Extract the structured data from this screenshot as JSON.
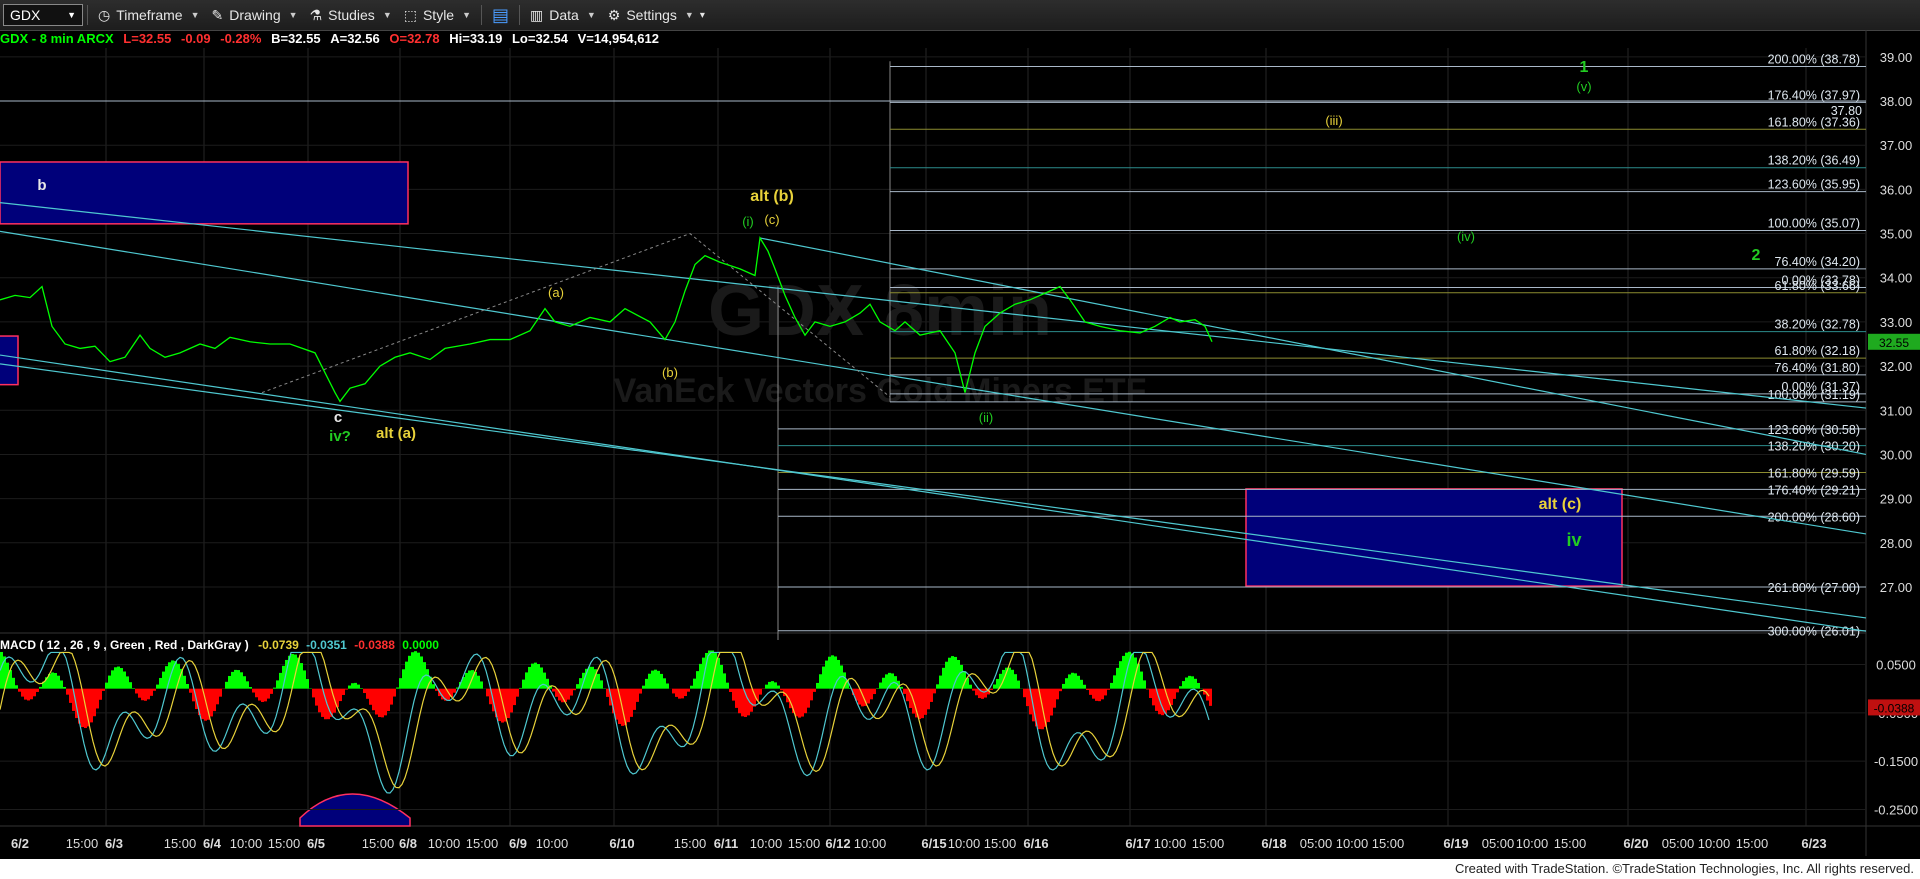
{
  "toolbar": {
    "symbol": "GDX",
    "items": [
      {
        "label": "Timeframe",
        "icon": "clock-icon"
      },
      {
        "label": "Drawing",
        "icon": "pencil-icon"
      },
      {
        "label": "Studies",
        "icon": "flask-icon"
      },
      {
        "label": "Style",
        "icon": "style-icon"
      },
      {
        "label": "Data",
        "icon": "bars-icon"
      },
      {
        "label": "Settings",
        "icon": "gear-icon"
      }
    ]
  },
  "quote": {
    "title": "GDX - 8 min  ARCX",
    "last": "L=32.55",
    "change": "-0.09",
    "pct": "-0.28%",
    "bid": "B=32.55",
    "ask": "A=32.56",
    "open": "O=32.78",
    "high": "Hi=33.19",
    "low": "Lo=32.54",
    "volume": "V=14,954,612"
  },
  "watermark": {
    "line1": "GDX 8min",
    "line2": "VanEck Vectors Gold Miners ETF"
  },
  "colors": {
    "up": "#00ff00",
    "down": "#ff0000",
    "wave_green": "#22cc22",
    "wave_yellow": "#e8d23a",
    "cyan": "#4fc8d0",
    "macd_line": "#4fc8d0",
    "signal_line": "#e8d23a",
    "box_fill": "#00007a",
    "box_border": "#ff3060"
  },
  "chart_data": [
    {
      "type": "line",
      "name": "GDX 8 min",
      "x_labels": [
        "6/2",
        "15:00",
        "6/3",
        "15:00",
        "6/4",
        "10:00",
        "15:00",
        "6/5",
        "15:00",
        "6/8",
        "10:00",
        "15:00",
        "6/9",
        "10:00",
        "6/10",
        "15:00",
        "6/11",
        "10:00",
        "15:00",
        "6/12",
        "10:00",
        "6/15",
        "10:00",
        "15:00",
        "6/16",
        "6/17",
        "10:00",
        "15:00",
        "6/18",
        "05:00",
        "10:00",
        "15:00",
        "6/19",
        "05:00",
        "10:00",
        "15:00",
        "6/20",
        "05:00",
        "10:00",
        "15:00",
        "6/23"
      ],
      "y_ticks": [
        39.0,
        38.0,
        37.0,
        36.0,
        35.0,
        34.0,
        33.0,
        32.0,
        31.0,
        30.0,
        29.0,
        28.0,
        27.0
      ],
      "ylim": [
        25.8,
        39.2
      ],
      "last_price": 32.55,
      "price_path": [
        [
          0,
          33.5
        ],
        [
          15,
          33.6
        ],
        [
          30,
          33.55
        ],
        [
          42,
          33.8
        ],
        [
          52,
          32.9
        ],
        [
          65,
          32.5
        ],
        [
          80,
          32.4
        ],
        [
          95,
          32.45
        ],
        [
          110,
          32.1
        ],
        [
          125,
          32.2
        ],
        [
          140,
          32.7
        ],
        [
          150,
          32.4
        ],
        [
          165,
          32.2
        ],
        [
          180,
          32.3
        ],
        [
          200,
          32.5
        ],
        [
          215,
          32.4
        ],
        [
          230,
          32.65
        ],
        [
          250,
          32.55
        ],
        [
          270,
          32.5
        ],
        [
          290,
          32.5
        ],
        [
          315,
          32.3
        ],
        [
          335,
          31.4
        ],
        [
          340,
          31.2
        ],
        [
          350,
          31.5
        ],
        [
          365,
          31.6
        ],
        [
          380,
          32.0
        ],
        [
          395,
          32.2
        ],
        [
          410,
          32.3
        ],
        [
          430,
          32.15
        ],
        [
          445,
          32.4
        ],
        [
          470,
          32.5
        ],
        [
          490,
          32.6
        ],
        [
          510,
          32.6
        ],
        [
          530,
          32.8
        ],
        [
          545,
          33.3
        ],
        [
          555,
          33.0
        ],
        [
          570,
          32.9
        ],
        [
          590,
          33.1
        ],
        [
          610,
          33.0
        ],
        [
          625,
          33.3
        ],
        [
          650,
          33.0
        ],
        [
          665,
          32.6
        ],
        [
          675,
          33.0
        ],
        [
          685,
          33.7
        ],
        [
          695,
          34.3
        ],
        [
          705,
          34.5
        ],
        [
          720,
          34.35
        ],
        [
          740,
          34.2
        ],
        [
          755,
          34.05
        ],
        [
          760,
          34.9
        ],
        [
          768,
          34.6
        ],
        [
          775,
          34.2
        ],
        [
          785,
          33.6
        ],
        [
          795,
          33.1
        ],
        [
          805,
          32.7
        ],
        [
          815,
          33.0
        ],
        [
          830,
          32.9
        ],
        [
          845,
          33.0
        ],
        [
          860,
          33.2
        ],
        [
          870,
          33.4
        ],
        [
          880,
          33.0
        ],
        [
          895,
          32.8
        ],
        [
          905,
          33.0
        ],
        [
          920,
          32.7
        ],
        [
          940,
          32.8
        ],
        [
          955,
          32.3
        ],
        [
          965,
          31.4
        ],
        [
          975,
          32.3
        ],
        [
          985,
          32.9
        ],
        [
          1000,
          33.2
        ],
        [
          1015,
          33.4
        ],
        [
          1030,
          33.5
        ],
        [
          1050,
          33.7
        ],
        [
          1060,
          33.8
        ],
        [
          1070,
          33.5
        ],
        [
          1085,
          33.0
        ],
        [
          1100,
          32.9
        ],
        [
          1120,
          32.8
        ],
        [
          1140,
          32.75
        ],
        [
          1155,
          32.9
        ],
        [
          1170,
          33.1
        ],
        [
          1180,
          33.0
        ],
        [
          1195,
          33.05
        ],
        [
          1205,
          32.9
        ],
        [
          1212,
          32.55
        ]
      ],
      "fib_levels_upper": [
        {
          "label": "200.00% (38.78)",
          "price": 38.78
        },
        {
          "label": "176.40% (37.97)",
          "price": 37.97
        },
        {
          "label": "161.80% (37.36)",
          "price": 37.36
        },
        {
          "label": "138.20% (36.49)",
          "price": 36.49
        },
        {
          "label": "123.60% (35.95)",
          "price": 35.95
        },
        {
          "label": "100.00% (35.07)",
          "price": 35.07
        },
        {
          "label": "76.40% (34.20)",
          "price": 34.2
        },
        {
          "label": "0.00% (33.78)",
          "price": 33.78
        },
        {
          "label": "61.80% (33.66)",
          "price": 33.66
        },
        {
          "label": "38.20% (32.78)",
          "price": 32.78
        },
        {
          "label": "61.80% (32.18)",
          "price": 32.18
        },
        {
          "label": "76.40% (31.80)",
          "price": 31.8
        },
        {
          "label": "0.00% (31.37)",
          "price": 31.37
        },
        {
          "label": "100.00% (31.19)",
          "price": 31.19
        }
      ],
      "fib_levels_lower": [
        {
          "label": "123.60% (30.58)",
          "price": 30.58
        },
        {
          "label": "138.20% (30.20)",
          "price": 30.2
        },
        {
          "label": "161.80% (29.59)",
          "price": 29.59
        },
        {
          "label": "176.40% (29.21)",
          "price": 29.21
        },
        {
          "label": "200.00% (28.60)",
          "price": 28.6
        },
        {
          "label": "261.80% (27.00)",
          "price": 27.0
        },
        {
          "label": "300.00% (26.01)",
          "price": 26.01
        }
      ],
      "price_tag_extra": "37.80",
      "wave_labels": [
        {
          "text": "b",
          "color": "white"
        },
        {
          "text": "c",
          "color": "white"
        },
        {
          "text": "iv?",
          "color": "green"
        },
        {
          "text": "alt (a)",
          "color": "yellow"
        },
        {
          "text": "(a)",
          "color": "yellow"
        },
        {
          "text": "(b)",
          "color": "yellow"
        },
        {
          "text": "alt (b)",
          "color": "yellow"
        },
        {
          "text": "(i)",
          "color": "green"
        },
        {
          "text": "(c)",
          "color": "yellow"
        },
        {
          "text": "(ii)",
          "color": "green"
        },
        {
          "text": "(iii)",
          "color": "yellow"
        },
        {
          "text": "(iv)",
          "color": "green"
        },
        {
          "text": "1",
          "color": "green"
        },
        {
          "text": "(v)",
          "color": "green"
        },
        {
          "text": "2",
          "color": "green"
        },
        {
          "text": "alt (c)",
          "color": "yellow"
        },
        {
          "text": "iv",
          "color": "green"
        }
      ]
    },
    {
      "type": "line",
      "name": "MACD",
      "title": "MACD ( 12 , 26 , 9 , Green , Red , DarkGray )",
      "values_text": [
        "-0.0739",
        "-0.0351",
        "-0.0388",
        "0.0000"
      ],
      "y_ticks": [
        0.05,
        -0.05,
        -0.15,
        -0.25
      ],
      "y_tick_labels": [
        "0.0500",
        "-0.0500",
        "-0.1500",
        "-0.2500"
      ],
      "current_label": "-0.0388",
      "ylim": [
        -0.28,
        0.08
      ]
    }
  ],
  "footer": "Created with TradeStation. ©TradeStation Technologies, Inc. All rights reserved."
}
